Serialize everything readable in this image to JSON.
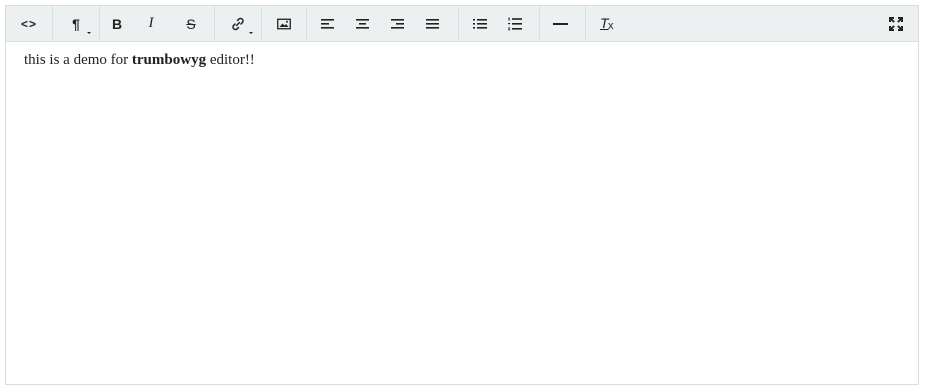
{
  "toolbar": {
    "view_html": {
      "label": "<>",
      "icon": "view-html-icon"
    },
    "formatting": {
      "icon": "paragraph-icon",
      "label": "¶"
    },
    "bold": {
      "label": "B"
    },
    "italic": {
      "label": "I"
    },
    "strikethrough": {
      "label": "S"
    },
    "link": {
      "icon": "link-icon"
    },
    "insert_image": {
      "icon": "image-icon"
    },
    "justify_left": {
      "icon": "align-left-icon"
    },
    "justify_center": {
      "icon": "align-center-icon"
    },
    "justify_right": {
      "icon": "align-right-icon"
    },
    "justify_full": {
      "icon": "align-justify-icon"
    },
    "unordered_list": {
      "icon": "bullet-list-icon"
    },
    "ordered_list": {
      "icon": "numbered-list-icon"
    },
    "horizontal_rule": {
      "icon": "horizontal-rule-icon"
    },
    "remove_format": {
      "label_main": "T",
      "label_sub": "x",
      "icon": "remove-format-icon"
    },
    "fullscreen": {
      "icon": "fullscreen-icon"
    }
  },
  "content": {
    "before": "this is a demo for ",
    "bold": "trumbowyg",
    "after": " editor!!"
  },
  "colors": {
    "toolbar_bg": "#ecf0f1",
    "border": "#dcdcdc",
    "icon": "#222222"
  }
}
